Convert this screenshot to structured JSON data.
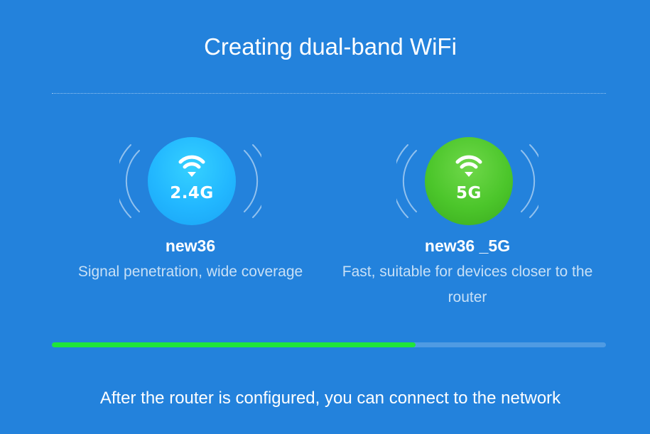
{
  "header": {
    "title": "Creating dual-band WiFi"
  },
  "bands": [
    {
      "band_label": "2.4G",
      "ssid": "new36",
      "description": "Signal penetration, wide coverage",
      "color": "#22b7ff",
      "icon": "wifi-icon"
    },
    {
      "band_label": "5G",
      "ssid": "new36 _5G",
      "description": "Fast, suitable for devices closer to the router",
      "color": "#4cc62b",
      "icon": "wifi-icon"
    }
  ],
  "progress": {
    "fraction": 0.656,
    "fill_color": "#1fe53a"
  },
  "footer": {
    "message": "After the router is configured, you can connect to the network"
  },
  "theme": {
    "background": "#2382dc"
  }
}
